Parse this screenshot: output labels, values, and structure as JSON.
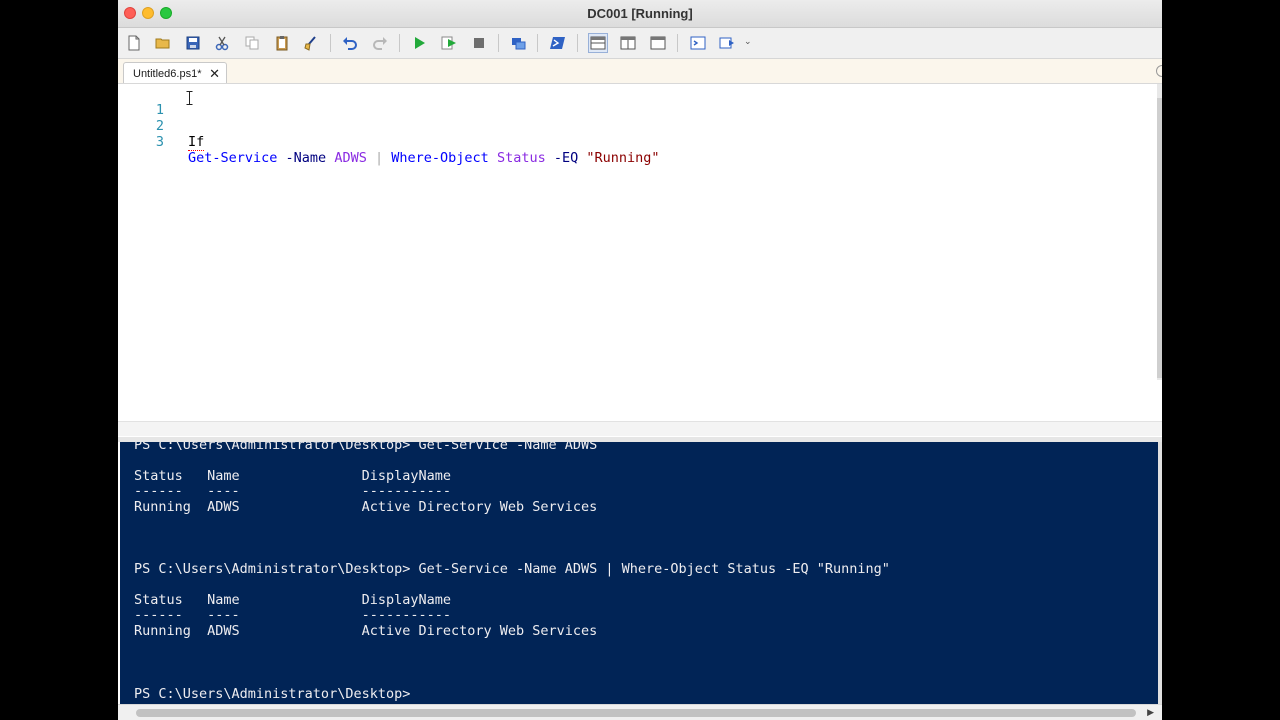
{
  "window": {
    "title": "DC001 [Running]"
  },
  "toolbar": {
    "buttons": [
      {
        "name": "new-script",
        "icon": "new-file-icon"
      },
      {
        "name": "open",
        "icon": "open-folder-icon"
      },
      {
        "name": "save",
        "icon": "save-icon"
      },
      {
        "name": "cut",
        "icon": "scissors-icon"
      },
      {
        "name": "copy",
        "icon": "copy-icon"
      },
      {
        "name": "paste",
        "icon": "clipboard-icon"
      },
      {
        "name": "clear-console",
        "icon": "broom-icon"
      },
      {
        "name": "undo",
        "icon": "undo-icon"
      },
      {
        "name": "redo",
        "icon": "redo-icon"
      },
      {
        "name": "run-script",
        "icon": "play-icon"
      },
      {
        "name": "run-selection",
        "icon": "run-selection-icon"
      },
      {
        "name": "stop",
        "icon": "stop-icon"
      },
      {
        "name": "remote-powershell",
        "icon": "remote-icon"
      },
      {
        "name": "start-powershell",
        "icon": "powershell-icon"
      },
      {
        "name": "show-script-top",
        "icon": "layout-top-icon"
      },
      {
        "name": "show-script-right",
        "icon": "layout-right-icon"
      },
      {
        "name": "show-script-max",
        "icon": "layout-max-icon"
      },
      {
        "name": "show-command-window",
        "icon": "command-window-icon"
      },
      {
        "name": "show-command-addon",
        "icon": "addon-icon"
      }
    ],
    "overflow": "⌄"
  },
  "tabs": [
    {
      "label": "Untitled6.ps1*",
      "close": "✕"
    }
  ],
  "editor": {
    "line_numbers": [
      "1",
      "2",
      "3"
    ],
    "line2": {
      "text": "If"
    },
    "line3": {
      "cmd1": "Get-Service",
      "param1": "-Name",
      "arg1": "ADWS",
      "pipe": "|",
      "cmd2": "Where-Object",
      "arg2": "Status",
      "param2": "-EQ",
      "str": "\"Running\""
    }
  },
  "console": {
    "lines": [
      "PS C:\\Users\\Administrator\\Desktop> Get-Service -Name ADWS",
      "Status   Name               DisplayName",
      "------   ----               -----------",
      "Running  ADWS               Active Directory Web Services",
      "PS C:\\Users\\Administrator\\Desktop> Get-Service -Name ADWS | Where-Object Status -EQ \"Running\"",
      "Status   Name               DisplayName",
      "------   ----               -----------",
      "Running  ADWS               Active Directory Web Services",
      "PS C:\\Users\\Administrator\\Desktop>"
    ]
  },
  "colors": {
    "console_bg": "#012456",
    "console_fg": "#eeedf0",
    "keyword_blue": "#0000ff",
    "argument_purple": "#8a2be2",
    "string_red": "#8b0000",
    "line_number": "#2b91af"
  }
}
